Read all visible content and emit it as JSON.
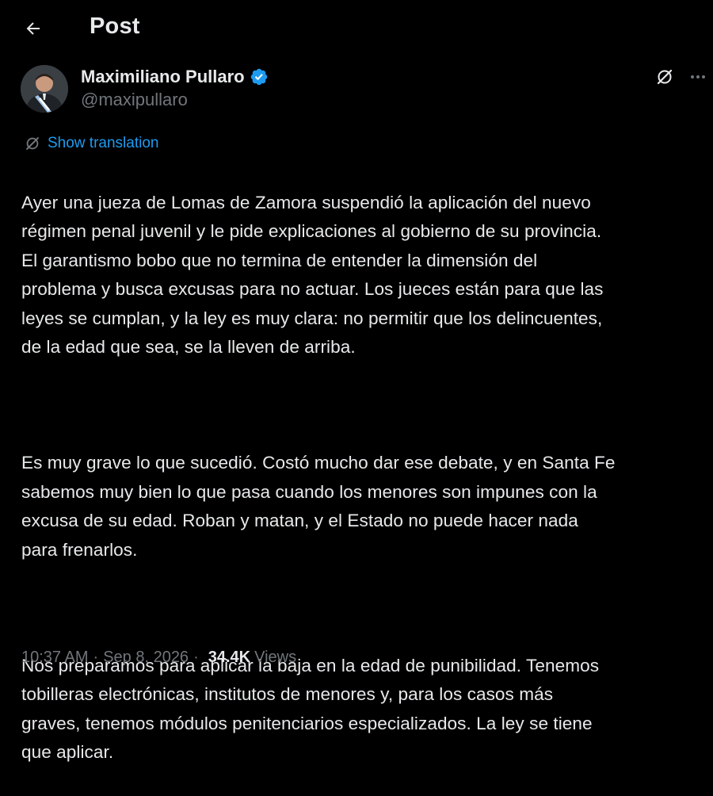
{
  "header": {
    "title": "Post"
  },
  "post": {
    "author_name": "Maximiliano Pullaro",
    "author_handle": "@maxipullaro",
    "translate_label": "Show translation",
    "paragraphs": [
      "Ayer una jueza de Lomas de Zamora suspendió la aplicación del nuevo\nrégimen penal juvenil y le pide explicaciones al gobierno de su provincia.\nEl garantismo bobo que no termina de entender la dimensión del\nproblema y busca excusas para no actuar. Los jueces están para que las\nleyes se cumplan, y la ley es muy clara: no permitir que los delincuentes,\nde la edad que sea, se la lleven de arriba.",
      "Es muy grave lo que sucedió. Costó mucho dar ese debate, y en Santa Fe\nsabemos muy bien lo que pasa cuando los menores son impunes con la\nexcusa de su edad. Roban y matan, y el Estado no puede hacer nada\npara frenarlos.",
      "Nos preparamos para aplicar la baja en la edad de punibilidad. Tenemos\ntobilleras electrónicas, institutos de menores y, para los casos más\ngraves, tenemos módulos penitenciarios especializados. La ley se tiene\nque aplicar."
    ],
    "time": "10:37 AM",
    "separator": "·",
    "date": "Sep 8, 2026",
    "views_count": "34.4K",
    "views_label": "Views"
  },
  "icons": {
    "back": "arrow-left-icon",
    "verified": "verified-badge-icon",
    "grok": "grok-icon",
    "more": "more-icon",
    "translate": "translate-icon"
  },
  "colors": {
    "background": "#000000",
    "text": "#e7e9ea",
    "secondary": "#71767b",
    "accent": "#1d9bf0"
  }
}
